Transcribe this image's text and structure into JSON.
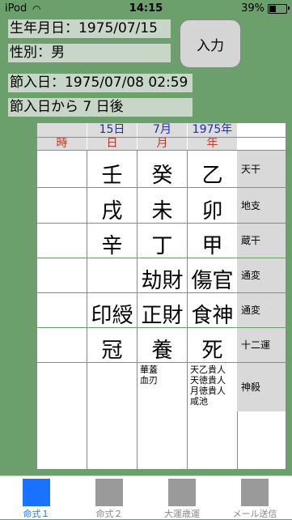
{
  "status": {
    "carrier": "iPod",
    "time": "14:15",
    "battery": "39%",
    "battery_level": 0.39
  },
  "birth": {
    "date_label": "生年月日：1975/07/15",
    "gender_label": "性別：男"
  },
  "button": {
    "input": "入力"
  },
  "setsu": {
    "label": "節入日：1975/07/08 02:59",
    "after": "節入日から 7 日後"
  },
  "chart": {
    "header_top": [
      "15日",
      "7月",
      "1975年"
    ],
    "header_pillars": [
      "時",
      "日",
      "月",
      "年"
    ],
    "rows": [
      {
        "label": "天干",
        "cells": [
          "",
          "壬",
          "癸",
          "乙"
        ]
      },
      {
        "label": "地支",
        "cells": [
          "",
          "戌",
          "未",
          "卯"
        ]
      },
      {
        "label": "蔵干",
        "cells": [
          "",
          "辛",
          "丁",
          "甲"
        ]
      },
      {
        "label": "通変",
        "cells": [
          "",
          "",
          "劫財",
          "傷官"
        ]
      },
      {
        "label": "通変",
        "cells": [
          "",
          "印綬",
          "正財",
          "食神"
        ]
      },
      {
        "label": "十二運",
        "cells": [
          "",
          "冠",
          "養",
          "死"
        ]
      }
    ],
    "shinsatsu_label": "神殺",
    "shinsatsu": {
      "month": [
        "華蓋",
        "血刃"
      ],
      "year": [
        "天乙貴人",
        "天徳貴人",
        "月徳貴人",
        "咸池"
      ]
    }
  },
  "tabs": [
    {
      "label": "命式１",
      "active": true
    },
    {
      "label": "命式２",
      "active": false
    },
    {
      "label": "大運歳運",
      "active": false
    },
    {
      "label": "メール送信",
      "active": false
    }
  ]
}
